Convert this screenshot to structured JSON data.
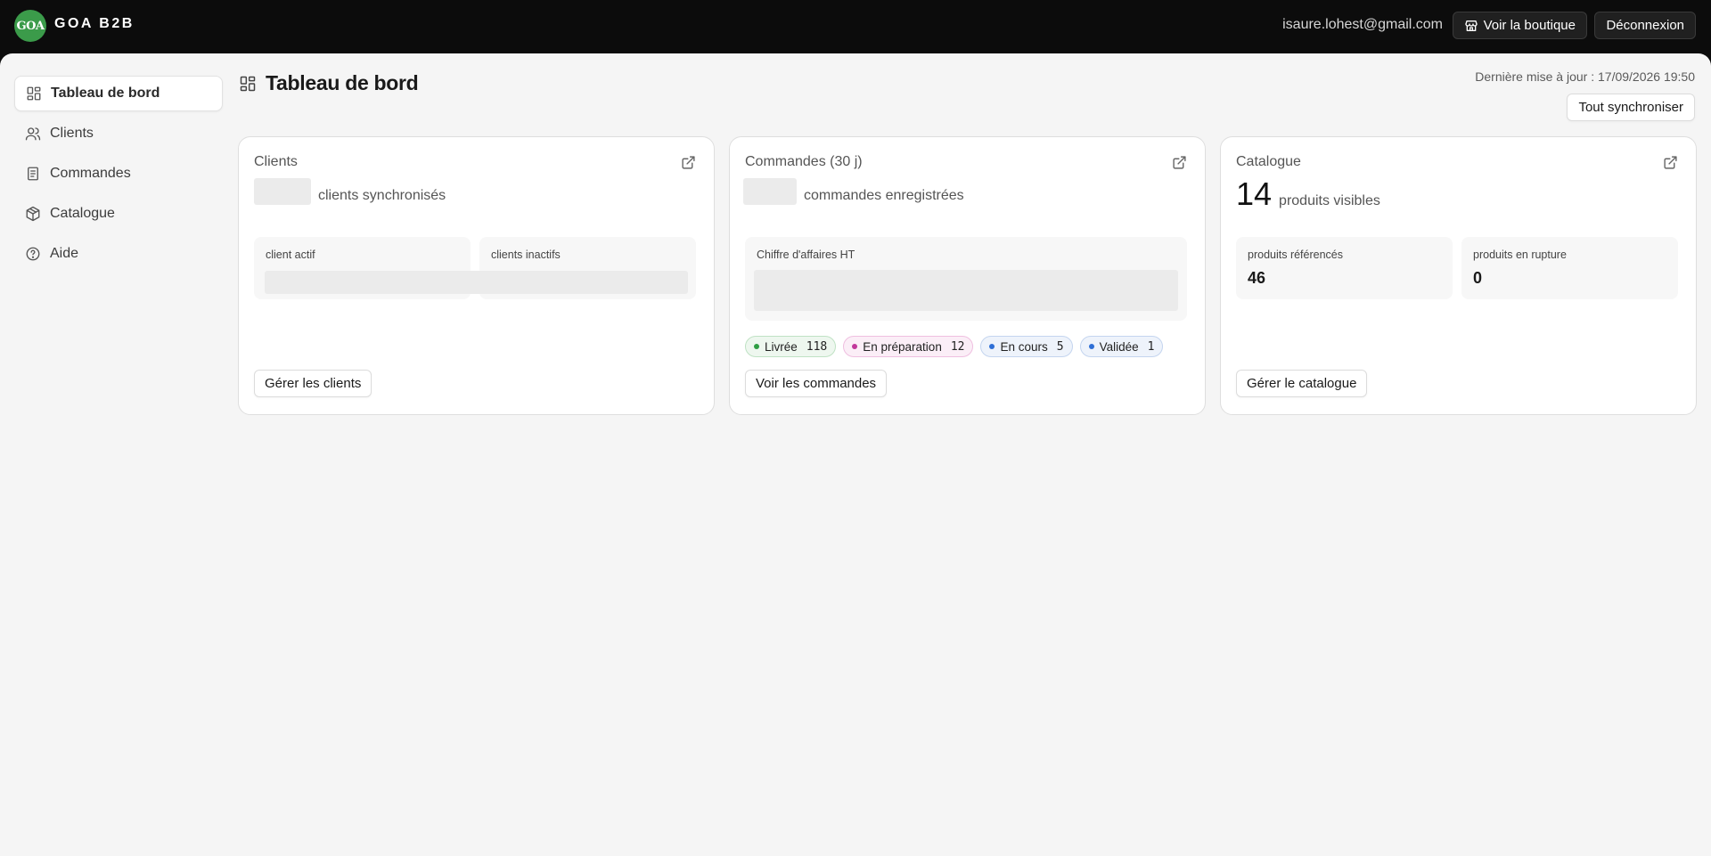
{
  "header": {
    "brand": "GOA B2B",
    "logo_text": "GOA",
    "user_email": "isaure.lohest@gmail.com",
    "shop_button": "Voir la boutique",
    "logout_button": "Déconnexion"
  },
  "sidebar": {
    "items": [
      {
        "label": "Tableau de bord",
        "icon": "dashboard-icon",
        "active": true
      },
      {
        "label": "Clients",
        "icon": "users-icon"
      },
      {
        "label": "Commandes",
        "icon": "document-icon"
      },
      {
        "label": "Catalogue",
        "icon": "box-icon"
      },
      {
        "label": "Aide",
        "icon": "help-icon"
      }
    ]
  },
  "page": {
    "title": "Tableau de bord",
    "last_update": "Dernière mise à jour : 17/09/2026 19:50",
    "sync_button": "Tout synchroniser"
  },
  "cards": {
    "clients": {
      "title": "Clients",
      "headline_label": "clients synchronisés",
      "stat_active": "client actif",
      "stat_inactive": "clients inactifs",
      "button": "Gérer les clients"
    },
    "orders": {
      "title": "Commandes (30 j)",
      "headline_label": "commandes enregistrées",
      "revenue_label": "Chiffre d'affaires HT",
      "statuses": [
        {
          "label": "Livrée",
          "count": "118",
          "color": "#2f9e44",
          "bg": "#eef7ef",
          "border": "#bfe2c4"
        },
        {
          "label": "En préparation",
          "count": "12",
          "color": "#c2379b",
          "bg": "#fbeef7",
          "border": "#efbfe0"
        },
        {
          "label": "En cours",
          "count": "5",
          "color": "#2f6fd6",
          "bg": "#eef3fb",
          "border": "#c4d5ef"
        },
        {
          "label": "Validée",
          "count": "1",
          "color": "#2f6fd6",
          "bg": "#eef3fb",
          "border": "#c4d5ef"
        }
      ],
      "button": "Voir les commandes"
    },
    "catalog": {
      "title": "Catalogue",
      "headline_value": "14",
      "headline_label": "produits visibles",
      "stat_referenced_label": "produits référencés",
      "stat_referenced_value": "46",
      "stat_outofstock_label": "produits en rupture",
      "stat_outofstock_value": "0",
      "button": "Gérer le catalogue"
    }
  },
  "colors": {
    "topbar": "#0c0c0c",
    "background": "#f5f5f5",
    "logo_green": "#3b9b4a"
  }
}
